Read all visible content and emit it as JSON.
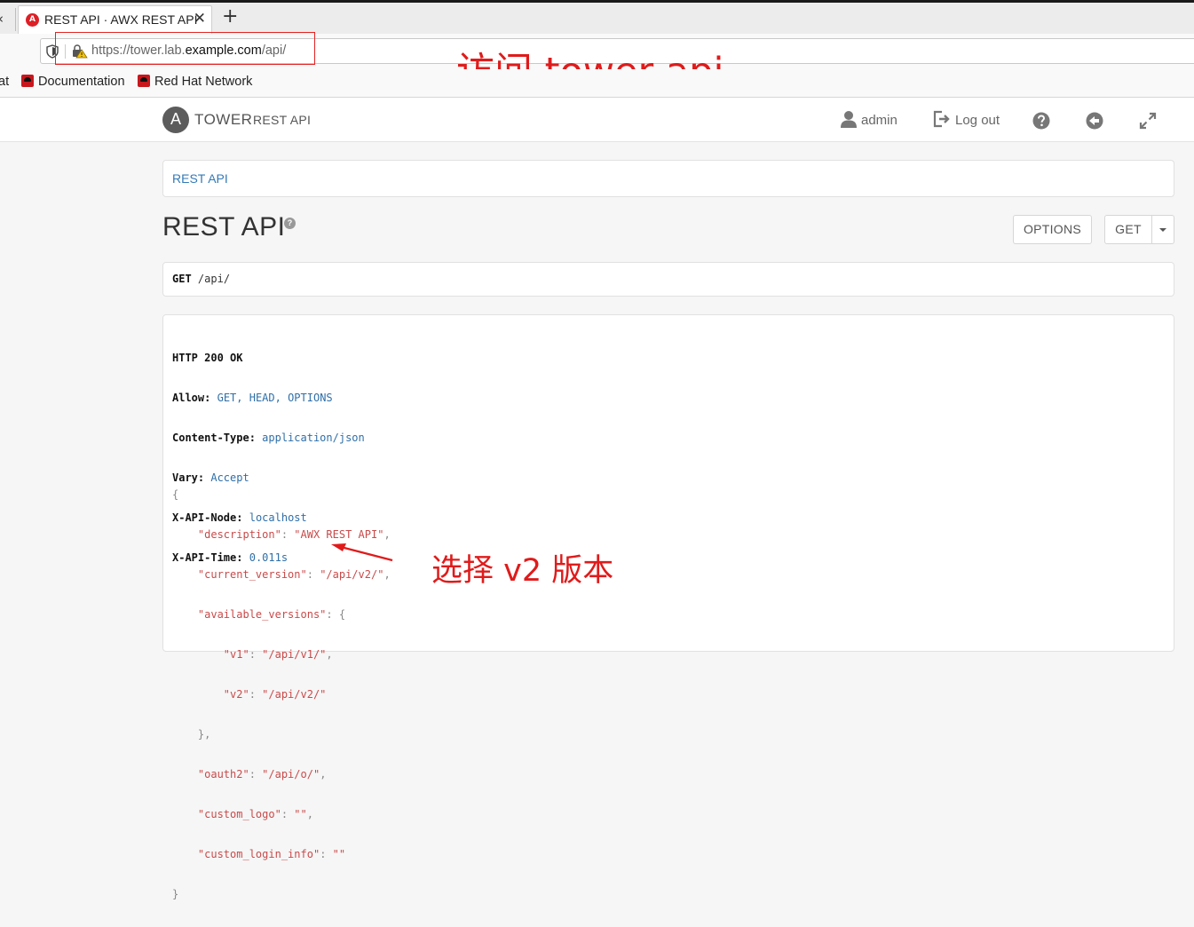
{
  "browser": {
    "tab_prev_glyph": "‹",
    "tab_title": "REST API · AWX REST API",
    "tab_favicon_letter": "A",
    "url_prefix": "https://tower.lab.",
    "url_domain": "example.com",
    "url_suffix": "/api/",
    "bookmarks": [
      {
        "label": "at"
      },
      {
        "label": "Documentation"
      },
      {
        "label": "Red Hat Network"
      }
    ]
  },
  "annotations": {
    "top": "访问 tower api",
    "bottom": "选择 v2 版本",
    "color": "#e01b1b"
  },
  "header": {
    "logo_letter": "A",
    "brand": "TOWER",
    "brand_sub": "REST API",
    "user": "admin",
    "logout": "Log out"
  },
  "breadcrumb": "REST API",
  "page_title": "REST API",
  "title_help_glyph": "?",
  "buttons": {
    "options": "OPTIONS",
    "get": "GET"
  },
  "request": {
    "method": "GET",
    "path": "/api/"
  },
  "response": {
    "status": "HTTP 200 OK",
    "headers": [
      {
        "key": "Allow:",
        "value": "GET, HEAD, OPTIONS"
      },
      {
        "key": "Content-Type:",
        "value": "application/json"
      },
      {
        "key": "Vary:",
        "value": "Accept"
      },
      {
        "key": "X-API-Node:",
        "value": "localhost"
      },
      {
        "key": "X-API-Time:",
        "value": "0.011s"
      }
    ],
    "body": {
      "open": "{",
      "close": "}",
      "description_key": "\"description\"",
      "description_val": "\"AWX REST API\"",
      "current_version_key": "\"current_version\"",
      "current_version_val": "\"/api/v2/\"",
      "available_versions_key": "\"available_versions\"",
      "v1_key": "\"v1\"",
      "v1_val": "\"/api/v1/\"",
      "v2_key": "\"v2\"",
      "v2_val": "\"/api/v2/\"",
      "oauth2_key": "\"oauth2\"",
      "oauth2_val": "\"/api/o/\"",
      "custom_logo_key": "\"custom_logo\"",
      "custom_logo_val": "\"\"",
      "custom_login_info_key": "\"custom_login_info\"",
      "custom_login_info_val": "\"\""
    }
  }
}
